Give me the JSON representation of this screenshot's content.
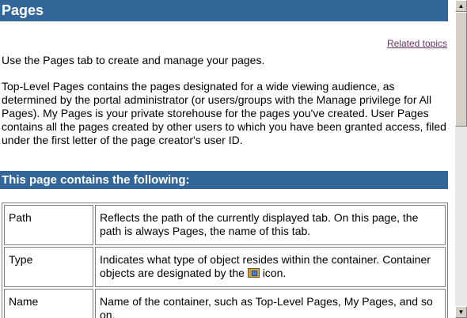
{
  "page": {
    "title": "Pages",
    "related_link": "Related topics",
    "intro": "Use the Pages tab to create and manage your pages.",
    "description": "Top-Level Pages contains the pages designated for a wide viewing audience, as determined by the portal administrator (or users/groups with the Manage privilege for All Pages). My Pages is your private storehouse for the pages you've created. User Pages contains all the pages created by other users to which you have been granted access, filed under the first letter of the page creator's user ID."
  },
  "section": {
    "title": "This page contains the following:"
  },
  "definitions": [
    {
      "term": "Path",
      "definition": "Reflects the path of the currently displayed tab. On this page, the path is always Pages, the name of this tab."
    },
    {
      "term": "Type",
      "definition_before": "Indicates what type of object resides within the container. Container objects are designated by the",
      "definition_after": "icon.",
      "icon": "container-icon"
    },
    {
      "term": "Name",
      "definition": "Name of the container, such as Top-Level Pages, My Pages, and so on."
    }
  ],
  "scrollbar": {
    "up_icon": "arrow-up-icon",
    "down_icon": "arrow-down-icon"
  }
}
